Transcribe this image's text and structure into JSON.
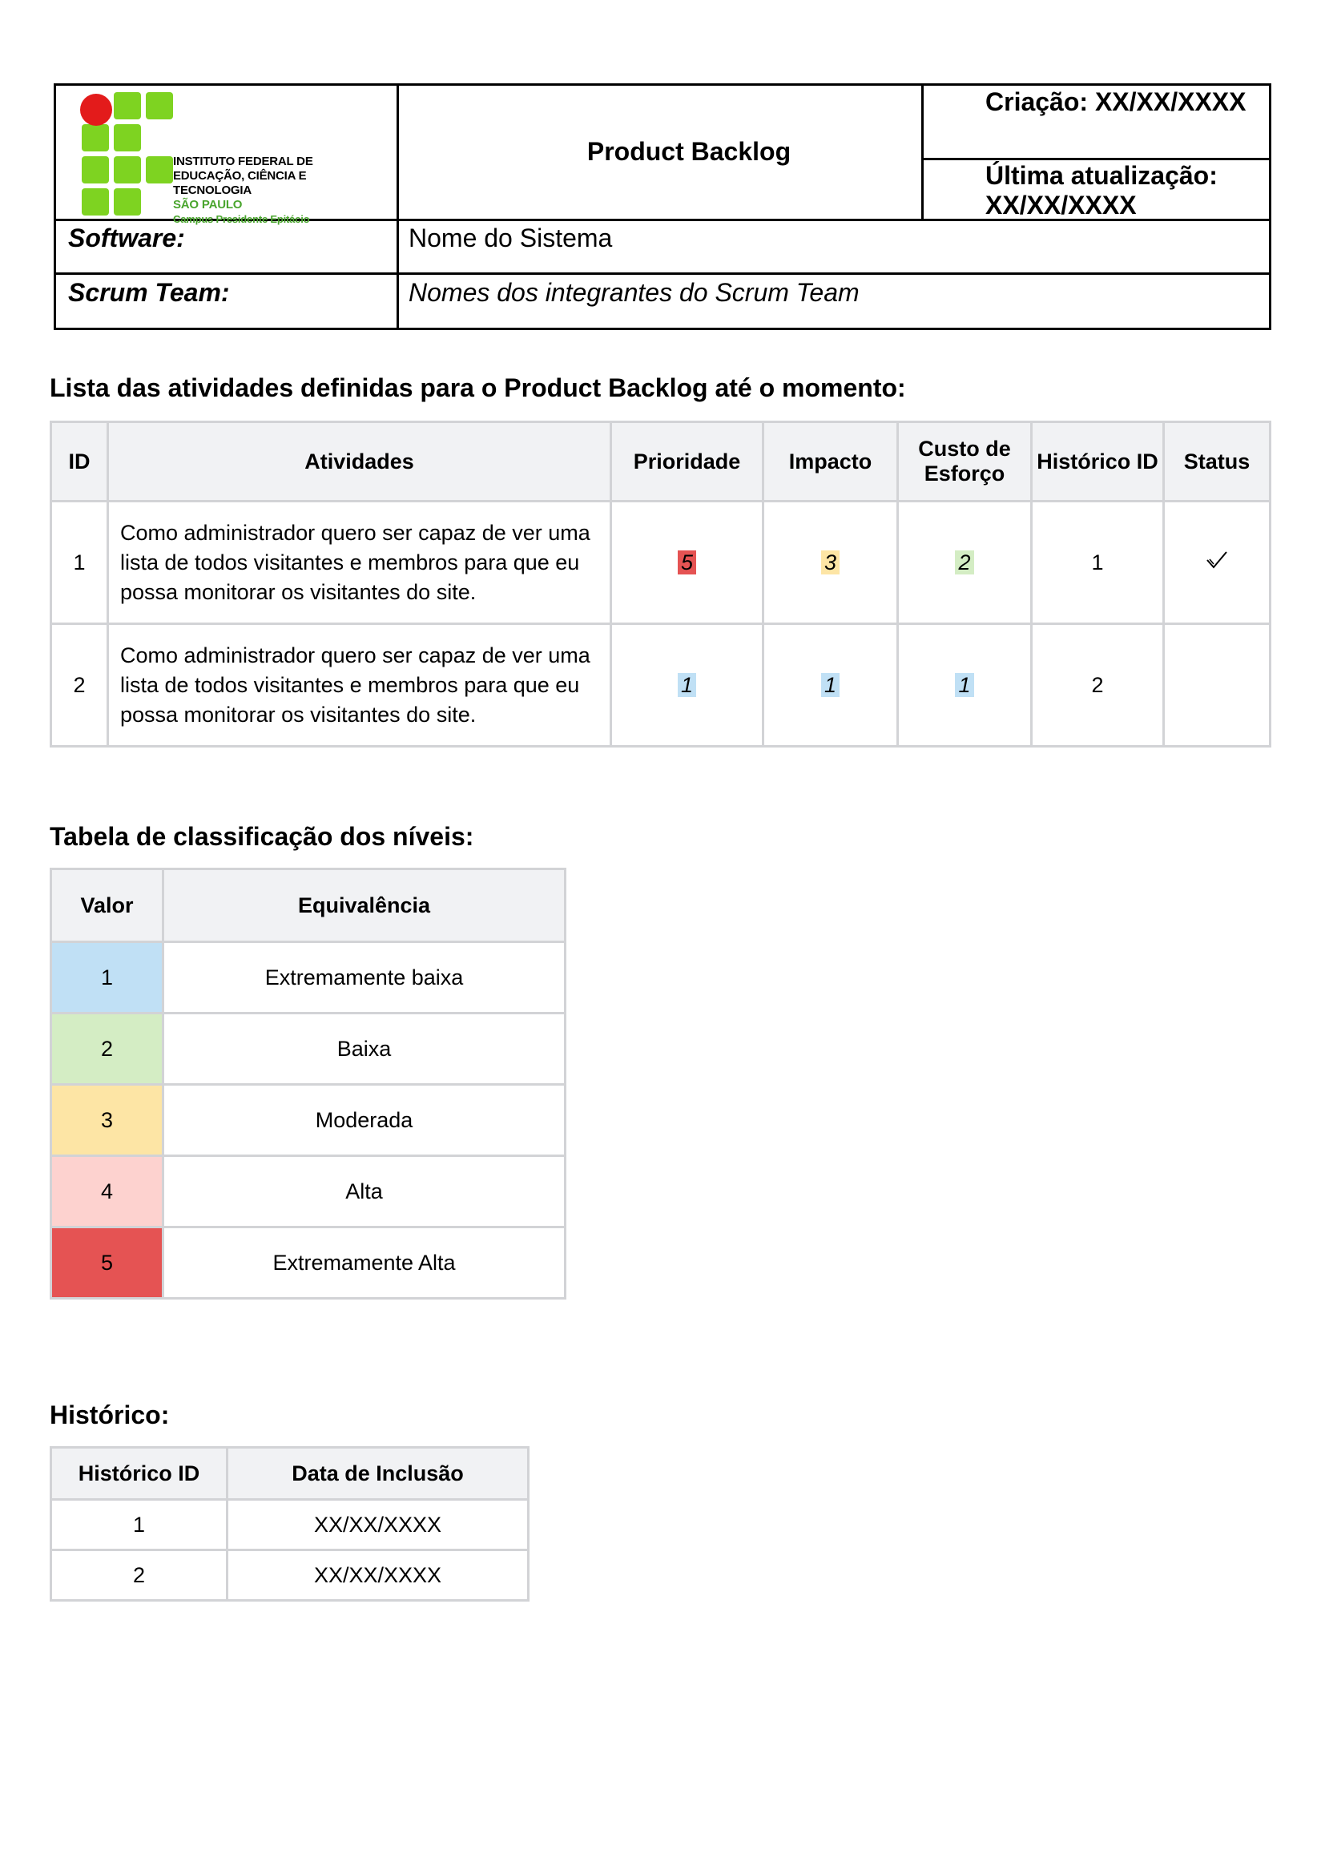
{
  "header": {
    "institution": {
      "line1": "INSTITUTO FEDERAL DE",
      "line2": "EDUCAÇÃO, CIÊNCIA E TECNOLOGIA",
      "line3": "SÃO PAULO",
      "line4": "Campus Presidente Epitácio"
    },
    "title": "Product Backlog",
    "created": "Criação: XX/XX/XXXX",
    "updated_line1": "Última atualização:",
    "updated_line2": "XX/XX/XXXX",
    "software_label": "Software:",
    "software_value": "Nome do Sistema",
    "team_label": "Scrum Team:",
    "team_value": "Nomes dos integrantes do Scrum Team"
  },
  "backlog": {
    "section_title": "Lista das atividades definidas para o Product Backlog até o momento:",
    "columns": [
      "ID",
      "Atividades",
      "Prioridade",
      "Impacto",
      "Custo de Esforço",
      "Histórico ID",
      "Status"
    ],
    "rows": [
      {
        "id": "1",
        "activity": "Como administrador quero ser capaz de ver uma lista de todos visitantes e membros para que eu possa monitorar os visitantes do site.",
        "priority": "5",
        "impact": "3",
        "effort": "2",
        "history_id": "1",
        "status_icon": "check-icon"
      },
      {
        "id": "2",
        "activity": "Como administrador quero ser capaz de ver uma lista de todos visitantes e membros para que eu possa monitorar os visitantes do site.",
        "priority": "1",
        "impact": "1",
        "effort": "1",
        "history_id": "2",
        "status_icon": ""
      }
    ]
  },
  "levels": {
    "section_title": "Tabela de classificação dos níveis:",
    "columns": [
      "Valor",
      "Equivalência"
    ],
    "rows": [
      {
        "value": "1",
        "label": "Extremamente baixa",
        "color": "#c0e0f5"
      },
      {
        "value": "2",
        "label": "Baixa",
        "color": "#d4edc4"
      },
      {
        "value": "3",
        "label": "Moderada",
        "color": "#fde5a5"
      },
      {
        "value": "4",
        "label": "Alta",
        "color": "#fdd2cf"
      },
      {
        "value": "5",
        "label": "Extremamente Alta",
        "color": "#e55353"
      }
    ]
  },
  "history": {
    "section_title": "Histórico:",
    "columns": [
      "Histórico ID",
      "Data de Inclusão"
    ],
    "rows": [
      {
        "id": "1",
        "date": "XX/XX/XXXX"
      },
      {
        "id": "2",
        "date": "XX/XX/XXXX"
      }
    ]
  },
  "colors": {
    "logo_green": "#7ed321",
    "logo_red": "#e31b1b",
    "table_border": "#d2d3d6",
    "header_fill": "#f1f2f4"
  }
}
